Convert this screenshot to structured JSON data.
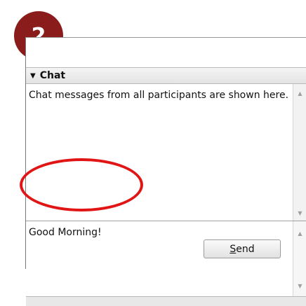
{
  "step": {
    "number": "2"
  },
  "chat": {
    "header": "Chat",
    "messages_text": "Chat messages from all participants are shown here.",
    "input_value": "Good Morning!",
    "send_label_first": "S",
    "send_label_rest": "end"
  },
  "colors": {
    "badge": "#8a1c1c",
    "highlight": "#e11515"
  },
  "icons": {
    "collapse": "chevron-down-icon",
    "scroll_up": "scroll-up-arrow-icon",
    "scroll_down": "scroll-down-arrow-icon"
  }
}
